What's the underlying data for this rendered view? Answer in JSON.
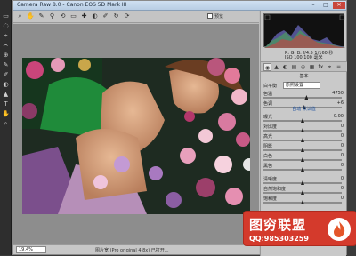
{
  "dialog": {
    "title": "Camera Raw 8.0  -  Canon EOS 5D Mark III",
    "min_label": "–",
    "max_label": "□",
    "close_label": "✕"
  },
  "ps_tools": [
    "▭",
    "◌",
    "⌖",
    "✂",
    "⊕",
    "✎",
    "✐",
    "◐",
    "▲",
    "T",
    "✋",
    "⌕"
  ],
  "toolbar": {
    "tools": [
      "⌕",
      "✋",
      "✎",
      "⚲",
      "⟲",
      "▭",
      "✚",
      "◐",
      "✐",
      "↻",
      "⟳"
    ],
    "preview_label": "预览"
  },
  "status": {
    "zoom": "19.4%",
    "meta": "图片宽  (Pro original  4.8x) 已打开..."
  },
  "panel": {
    "rgb_readout": "R:  G:  B:  f/4.5  1/160 秒",
    "exif_readout": "ISO 100  100 毫米",
    "tabs": [
      "◉",
      "▲",
      "◐",
      "▤",
      "◎",
      "▦",
      "fx",
      "⌖",
      "≡"
    ],
    "section_title": "基本",
    "white_balance_label": "白平衡",
    "white_balance_value": "原照设置",
    "auto_links": "自动    默认值",
    "sliders": [
      {
        "label": "色温",
        "value": "4750",
        "fraction": 0.55
      },
      {
        "label": "色调",
        "value": "+6",
        "fraction": 0.52
      },
      {
        "label": "曝光",
        "value": "0.00",
        "fraction": 0.5
      },
      {
        "label": "对比度",
        "value": "0",
        "fraction": 0.5
      },
      {
        "label": "高光",
        "value": "0",
        "fraction": 0.5
      },
      {
        "label": "阴影",
        "value": "0",
        "fraction": 0.5
      },
      {
        "label": "白色",
        "value": "0",
        "fraction": 0.5
      },
      {
        "label": "黑色",
        "value": "0",
        "fraction": 0.5
      },
      {
        "label": "清晰度",
        "value": "0",
        "fraction": 0.5
      },
      {
        "label": "自然饱和度",
        "value": "0",
        "fraction": 0.5
      },
      {
        "label": "饱和度",
        "value": "0",
        "fraction": 0.5
      }
    ]
  },
  "watermark": {
    "title": "图穷联盟",
    "qq": "QQ:985303259"
  }
}
